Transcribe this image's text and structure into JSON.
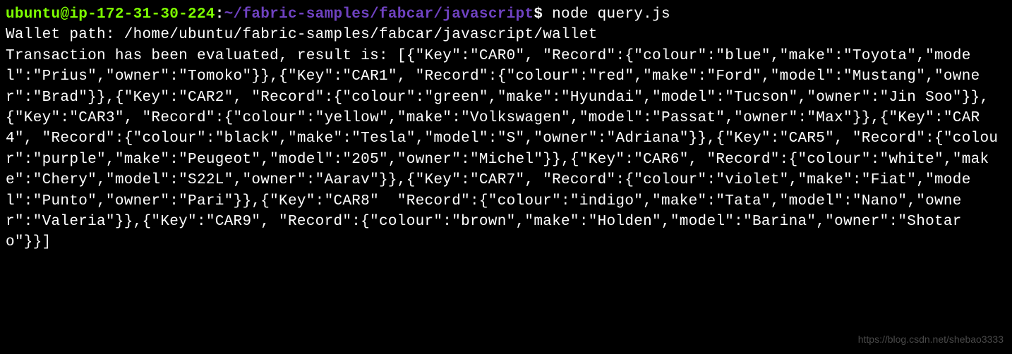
{
  "prompt": {
    "user": "ubuntu@ip-172-31-30-224",
    "sep1": ":",
    "path": "~/fabric-samples/fabcar/javascript",
    "dollar": "$",
    "command": " node query.js"
  },
  "output": {
    "wallet_line": "Wallet path: /home/ubuntu/fabric-samples/fabcar/javascript/wallet",
    "result_prefix": "Transaction has been evaluated, result is: ",
    "result_json": "[{\"Key\":\"CAR0\", \"Record\":{\"colour\":\"blue\",\"make\":\"Toyota\",\"model\":\"Prius\",\"owner\":\"Tomoko\"}},{\"Key\":\"CAR1\", \"Record\":{\"colour\":\"red\",\"make\":\"Ford\",\"model\":\"Mustang\",\"owner\":\"Brad\"}},{\"Key\":\"CAR2\", \"Record\":{\"colour\":\"green\",\"make\":\"Hyundai\",\"model\":\"Tucson\",\"owner\":\"Jin Soo\"}},{\"Key\":\"CAR3\", \"Record\":{\"colour\":\"yellow\",\"make\":\"Volkswagen\",\"model\":\"Passat\",\"owner\":\"Max\"}},{\"Key\":\"CAR4\", \"Record\":{\"colour\":\"black\",\"make\":\"Tesla\",\"model\":\"S\",\"owner\":\"Adriana\"}},{\"Key\":\"CAR5\", \"Record\":{\"colour\":\"purple\",\"make\":\"Peugeot\",\"model\":\"205\",\"owner\":\"Michel\"}},{\"Key\":\"CAR6\", \"Record\":{\"colour\":\"white\",\"make\":\"Chery\",\"model\":\"S22L\",\"owner\":\"Aarav\"}},{\"Key\":\"CAR7\", \"Record\":{\"colour\":\"violet\",\"make\":\"Fiat\",\"model\":\"Punto\",\"owner\":\"Pari\"}},{\"Key\":\"CAR8\"  \"Record\":{\"colour\":\"indigo\",\"make\":\"Tata\",\"model\":\"Nano\",\"owner\":\"Valeria\"}},{\"Key\":\"CAR9\", \"Record\":{\"colour\":\"brown\",\"make\":\"Holden\",\"model\":\"Barina\",\"owner\":\"Shotaro\"}}]"
  },
  "watermark": "https://blog.csdn.net/shebao3333"
}
